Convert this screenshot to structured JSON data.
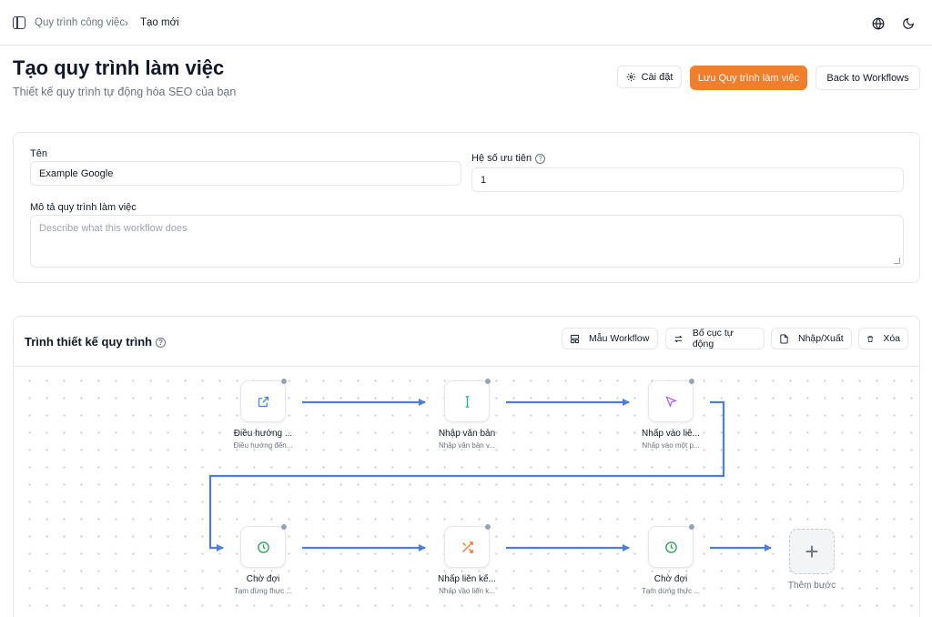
{
  "breadcrumb": {
    "parent": "Quy trình công việc",
    "separator": "›",
    "current": "Tạo mới"
  },
  "header": {
    "title": "Tạo quy trình làm việc",
    "subtitle": "Thiết kế quy trình tự động hóa SEO của bạn",
    "settings_label": "Cài đặt",
    "save_label": "Lưu Quy trình làm việc",
    "back_label": "Back to Workflows"
  },
  "form": {
    "name_label": "Tên",
    "name_value": "Example Google",
    "priority_label": "Hệ số ưu tiên",
    "priority_value": "1",
    "description_label": "Mô tả quy trình làm việc",
    "description_placeholder": "Describe what this workflow does"
  },
  "designer": {
    "title": "Trình thiết kế quy trình",
    "templates_label": "Mẫu Workflow",
    "auto_layout_label": "Bố cục tự động",
    "import_export_label": "Nhập/Xuất",
    "delete_label": "Xóa",
    "add_step_label": "Thêm bước",
    "nodes": [
      {
        "title": "Điều hướng ...",
        "desc": "Điều hướng đến...",
        "icon": "external-link-icon",
        "color": "#3b82f6"
      },
      {
        "title": "Nhập văn bản",
        "desc": "Nhập văn bản v...",
        "icon": "text-cursor-icon",
        "color": "#10b981"
      },
      {
        "title": "Nhấp vào liê...",
        "desc": "Nhấp vào một p...",
        "icon": "pointer-icon",
        "color": "#a855f7"
      },
      {
        "title": "Chờ đợi",
        "desc": "Tạm dừng thực ...",
        "icon": "clock-icon",
        "color": "#16a34a"
      },
      {
        "title": "Nhấp liên kế...",
        "desc": "Nhấp vào liên k...",
        "icon": "shuffle-icon",
        "color": "#f97316"
      },
      {
        "title": "Chờ đợi",
        "desc": "Tạm dừng thực ...",
        "icon": "clock-icon",
        "color": "#16a34a"
      }
    ]
  },
  "colors": {
    "accent": "#f07f2d",
    "wire": "#4a7fe0"
  }
}
